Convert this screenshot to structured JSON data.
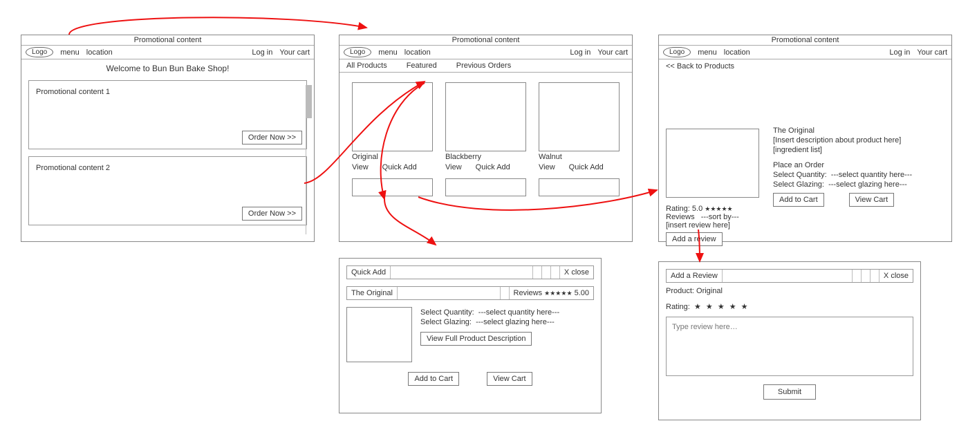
{
  "shared_header": {
    "promo_banner": "Promotional content",
    "logo": "Logo",
    "menu": "menu",
    "location": "location",
    "login": "Log in",
    "cart": "Your cart"
  },
  "home": {
    "welcome": "Welcome to Bun Bun Bake Shop!",
    "promo1": "Promotional content 1",
    "promo2": "Promotional content 2",
    "order_now": "Order Now >>"
  },
  "listing": {
    "tabs": {
      "all": "All Products",
      "featured": "Featured",
      "previous": "Previous Orders"
    },
    "products": [
      {
        "name": "Original",
        "view": "View",
        "quick_add": "Quick Add"
      },
      {
        "name": "Blackberry",
        "view": "View",
        "quick_add": "Quick Add"
      },
      {
        "name": "Walnut",
        "view": "View",
        "quick_add": "Quick Add"
      }
    ]
  },
  "detail": {
    "back": "<< Back to Products",
    "title": "The Original",
    "desc": "[Insert description about product here]",
    "ingredients": "[ingredient list]",
    "place_order": "Place an Order",
    "qty_label": "Select Quantity:",
    "qty_placeholder": "---select quantity here---",
    "glazing_label": "Select Glazing:",
    "glazing_placeholder": "---select glazing here---",
    "add_to_cart": "Add to Cart",
    "view_cart": "View Cart",
    "rating_label": "Rating: 5.0",
    "rating_stars": "★★★★★",
    "reviews_label": "Reviews",
    "sort_by": "---sort by---",
    "review_placeholder": "[insert review here]",
    "add_review": "Add a review"
  },
  "quick_add_modal": {
    "header": "Quick Add",
    "close": "X close",
    "product": "The Original",
    "reviews_label": "Reviews",
    "stars": "★★★★★",
    "rating_num": "5.00",
    "qty_label": "Select Quantity:",
    "qty_placeholder": "---select quantity here---",
    "glazing_label": "Select Glazing:",
    "glazing_placeholder": "---select glazing here---",
    "view_full": "View Full Product Description",
    "add_to_cart": "Add to Cart",
    "view_cart": "View Cart"
  },
  "review_modal": {
    "header": "Add a Review",
    "close": "X close",
    "product_label": "Product: Original",
    "rating_label": "Rating:",
    "stars": "★  ★  ★  ★  ★",
    "placeholder": "Type review here…",
    "submit": "Submit"
  }
}
